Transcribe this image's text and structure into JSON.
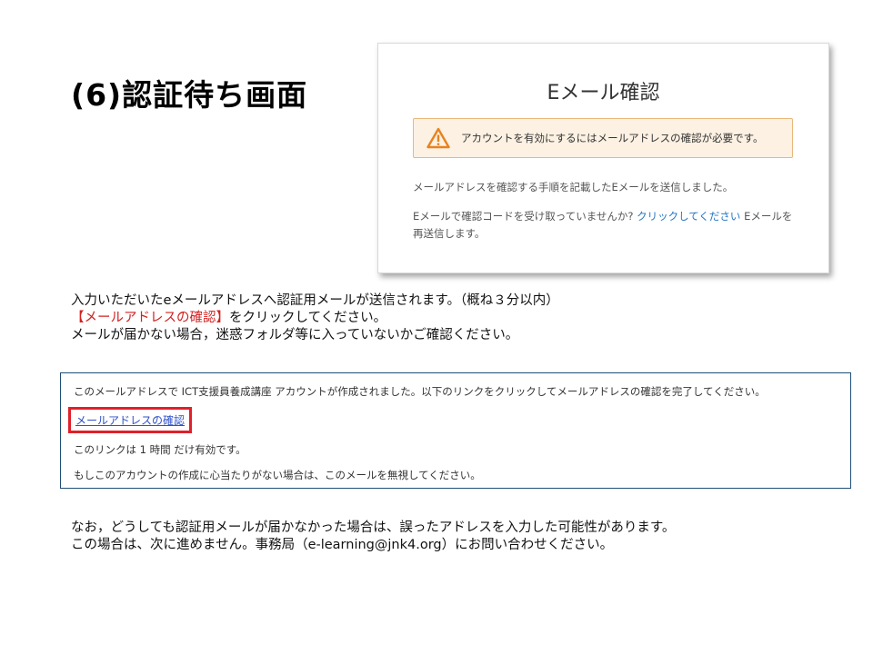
{
  "slide": {
    "title": "(6)認証待ち画面"
  },
  "confirm_dialog": {
    "title": "Eメール確認",
    "alert_text": "アカウントを有効にするにはメールアドレスの確認が必要です。",
    "message1": "メールアドレスを確認する手順を記載したEメールを送信しました。",
    "message2_prefix": "Eメールで確認コードを受け取っていませんか? ",
    "message2_link": "クリックしてください",
    "message2_suffix": " Eメールを再送信します。",
    "alert_icon": "warning-triangle-icon"
  },
  "instructions": {
    "line1": "入力いただいたeメールアドレスへ認証用メールが送信されます。（概ね３分以内）",
    "line2_highlight": "【メールアドレスの確認】",
    "line2_rest": "をクリックしてください。",
    "line3": "メールが届かない場合，迷惑フォルダ等に入っていないかご確認ください。"
  },
  "email_preview": {
    "line1": "このメールアドレスで ICT支援員養成講座 アカウントが作成されました。以下のリンクをクリックしてメールアドレスの確認を完了してください。",
    "link": "メールアドレスの確認",
    "line2": "このリンクは 1 時間 だけ有効です。",
    "line3": "もしこのアカウントの作成に心当たりがない場合は、このメールを無視してください。"
  },
  "footer": {
    "line1": "なお，どうしても認証用メールが届かなかった場合は、誤ったアドレスを入力した可能性があります。",
    "line2": "この場合は、次に進めません。事務局（e-learning@jnk4.org）にお問い合わせください。"
  },
  "colors": {
    "alert_bg": "#fcf1e2",
    "alert_border": "#eab77a",
    "alert_icon": "#e8821e",
    "link_blue": "#2275c6",
    "highlight_red": "#d42020",
    "link_box_red": "#e0202a"
  }
}
